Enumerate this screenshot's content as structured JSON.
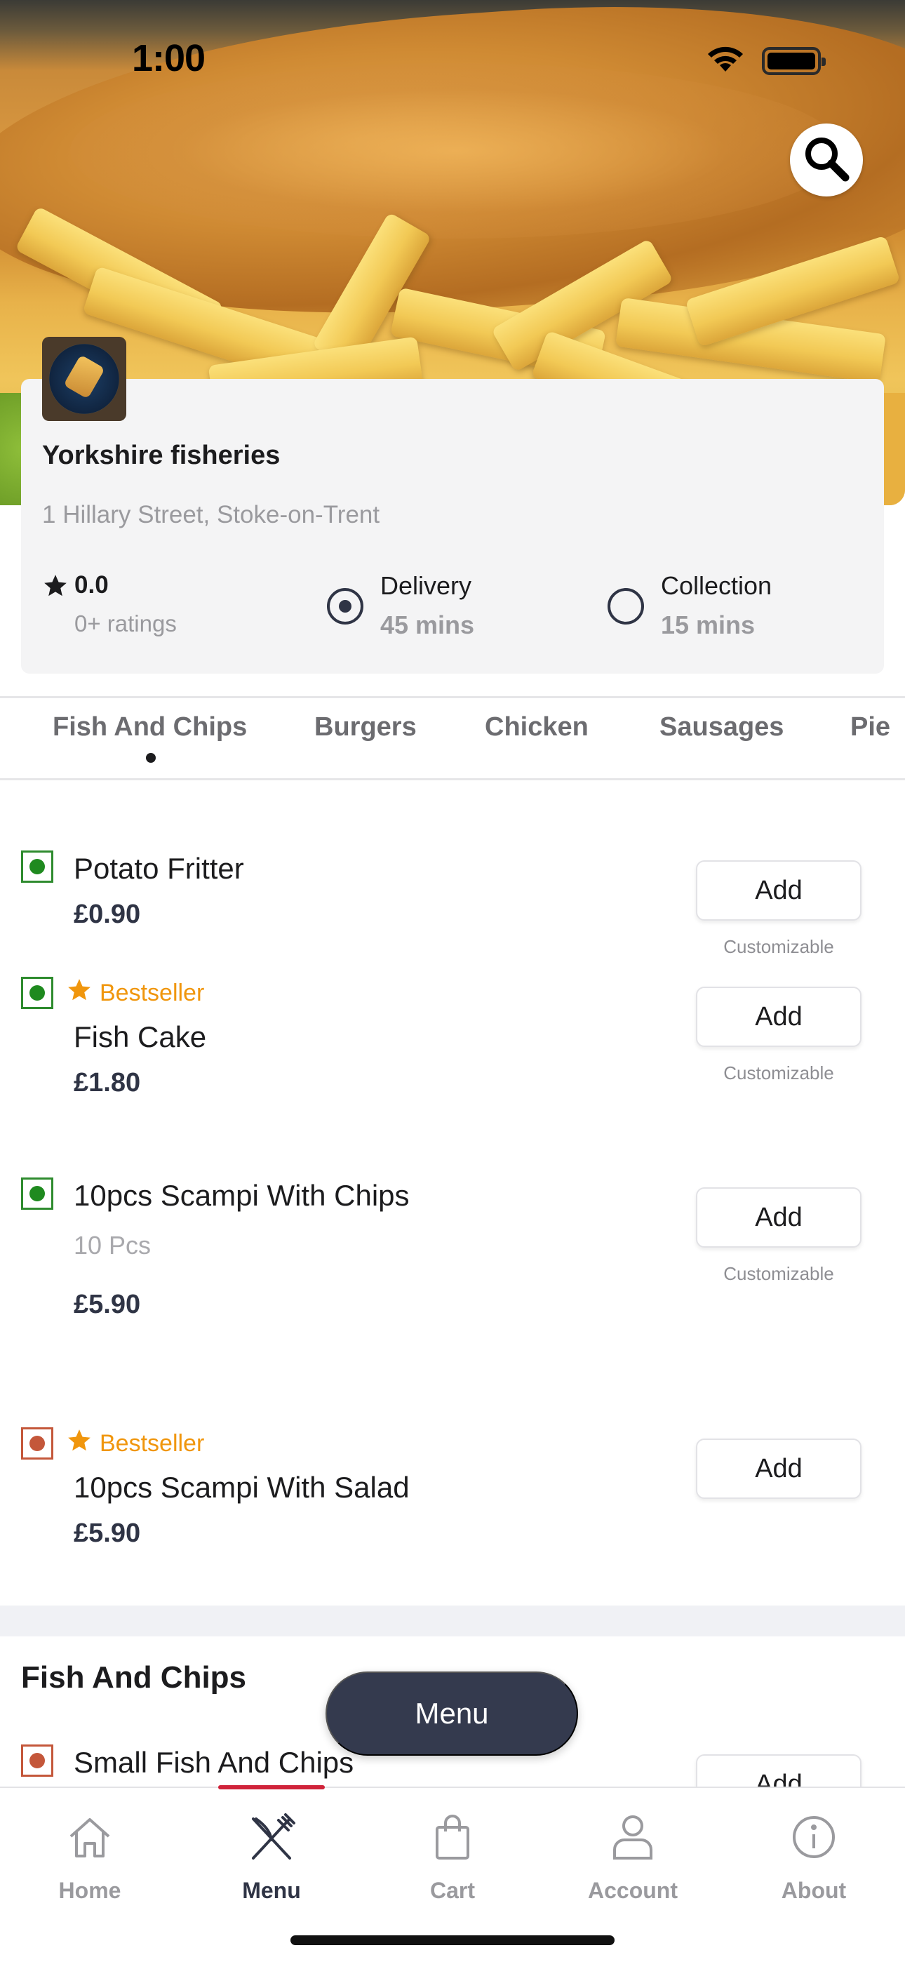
{
  "status_bar": {
    "time": "1:00"
  },
  "restaurant": {
    "name": "Yorkshire fisheries",
    "address": "1 Hillary Street, Stoke-on-Trent",
    "rating": "0.0",
    "ratings_count": "0+ ratings"
  },
  "order_modes": [
    {
      "label": "Delivery",
      "time": "45 mins",
      "selected": true
    },
    {
      "label": "Collection",
      "time": "15 mins",
      "selected": false
    }
  ],
  "categories": [
    "Fish And Chips",
    "Burgers",
    "Chicken",
    "Sausages",
    "Pie"
  ],
  "active_category": "Fish And Chips",
  "items": [
    {
      "name": "Potato Fritter",
      "price": "£0.90",
      "type": "veg",
      "bestseller": false,
      "customizable": true,
      "button": "Add"
    },
    {
      "name": "Fish Cake",
      "price": "£1.80",
      "type": "veg",
      "bestseller": true,
      "customizable": true,
      "button": "Add"
    },
    {
      "name": "10pcs Scampi With Chips",
      "description": "10 Pcs",
      "price": "£5.90",
      "type": "veg",
      "bestseller": false,
      "customizable": true,
      "button": "Add"
    },
    {
      "name": "10pcs Scampi With Salad",
      "price": "£5.90",
      "type": "non-veg",
      "bestseller": true,
      "customizable": false,
      "button": "Add"
    }
  ],
  "labels": {
    "bestseller": "Bestseller",
    "customizable": "Customizable"
  },
  "section": {
    "title": "Fish And Chips",
    "first_item": {
      "name": "Small Fish And Chips",
      "type": "non-veg",
      "button": "Add"
    }
  },
  "floating_menu_button": "Menu",
  "bottom_nav": [
    {
      "label": "Home",
      "icon": "home-icon",
      "active": false
    },
    {
      "label": "Menu",
      "icon": "fork-knife-icon",
      "active": true
    },
    {
      "label": "Cart",
      "icon": "bag-icon",
      "active": false
    },
    {
      "label": "Account",
      "icon": "user-icon",
      "active": false
    },
    {
      "label": "About",
      "icon": "info-icon",
      "active": false
    }
  ],
  "colors": {
    "accent_dark": "#343a4e",
    "nav_active_indicator": "#d0233a",
    "veg_green": "#1f8a1f",
    "nonveg_red": "#c4573a",
    "bestseller_orange": "#f0960d"
  }
}
